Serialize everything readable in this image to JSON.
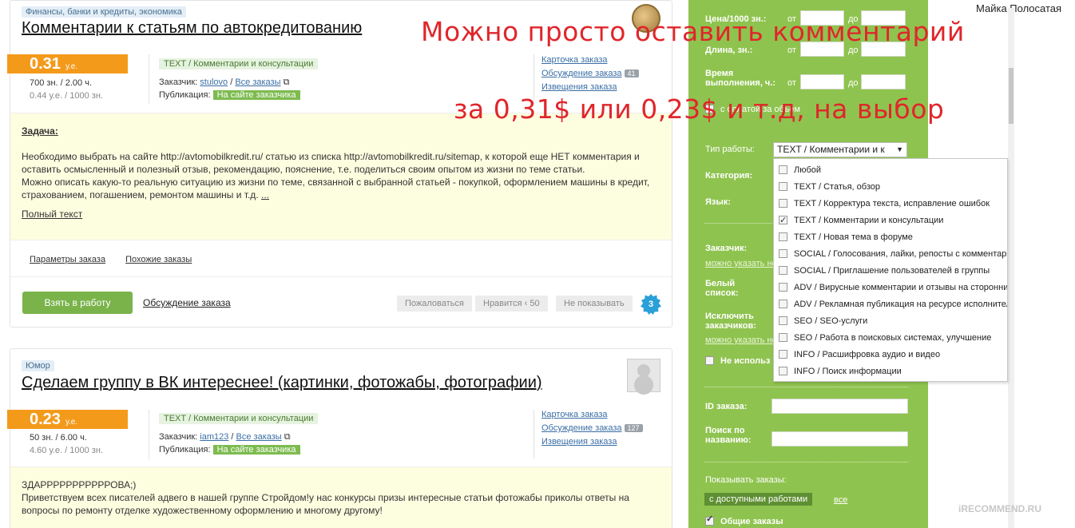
{
  "user": {
    "name": "Майка Полосатая"
  },
  "annotation": {
    "line1": "Можно просто оставить комментарий",
    "line2": "за 0,31$ или 0,23$ и т.д, на выбор"
  },
  "orders": [
    {
      "category": "Финансы, банки и кредиты, экономика",
      "title": "Комментарии к статьям по автокредитованию",
      "price": "0.31",
      "currency": "у.е.",
      "volume": "700 зн. / 2.00 ч.",
      "rate": "0.44 у.е. / 1000 зн.",
      "work_type": "TEXT / Комментарии и консультации",
      "customer_label": "Заказчик:",
      "customer": "stulovo",
      "all_orders": "Все заказы",
      "publication_label": "Публикация:",
      "publication": "На сайте заказчика",
      "links": {
        "card": "Карточка заказа",
        "discussion": "Обсуждение заказа",
        "discussion_count": "41",
        "notices": "Извещения заказа"
      },
      "task_heading": "Задача:",
      "task_text": "Необходимо выбрать на сайте http://avtomobilkredit.ru/ статью из списка http://avtomobilkredit.ru/sitemap, к которой еще НЕТ комментария и оставить осмысленный и полезный отзыв, рекомендацию, пояснение, т.е. поделиться своим опытом из жизни по теме статьи.",
      "task_text2": "Можно описать какую-то реальную ситуацию из жизни по теме, связанной с выбранной статьей - покупкой, оформлением машины в кредит, страхованием, погашением, ремонтом машины и т.д.",
      "more": "...",
      "full_text": "Полный текст",
      "params": "Параметры заказа",
      "similar": "Похожие заказы",
      "take_button": "Взять в работу",
      "discussion_link": "Обсуждение заказа",
      "complain": "Пожаловаться",
      "likes": "Нравится",
      "likes_count": "50",
      "hide": "Не показывать",
      "badge": "3"
    },
    {
      "category": "Юмор",
      "title": "Сделаем группу в ВК интереснее! (картинки, фотожабы, фотографии)",
      "price": "0.23",
      "currency": "у.е.",
      "volume": "50 зн. / 6.00 ч.",
      "rate": "4.60 у.е. / 1000 зн.",
      "work_type": "TEXT / Комментарии и консультации",
      "customer_label": "Заказчик:",
      "customer": "iam123",
      "all_orders": "Все заказы",
      "publication_label": "Публикация:",
      "publication": "На сайте заказчика",
      "links": {
        "card": "Карточка заказа",
        "discussion": "Обсуждение заказа",
        "discussion_count": "127",
        "notices": "Извещения заказа"
      },
      "task_line1": "ЗДАРРРРРРРРРРРОВА;)",
      "task_line2": "Приветствуем всех писателей адвего в нашей группе Стройдом!у нас конкурсы призы интересные статьи фотожабы приколы ответы на вопросы по ремонту отделке художественному оформлению и многому другому!"
    }
  ],
  "filter": {
    "price_label": "Цена/1000 зн.:",
    "length_label": "Длина, зн.:",
    "time_label": "Время выполнения, ч.:",
    "from": "от",
    "to": "до",
    "volume_check": "с оплатой за объем",
    "work_type_label": "Тип работы:",
    "work_type_value": "TEXT / Комментарии и к",
    "category_label": "Категория:",
    "language_label": "Язык:",
    "customer_label": "Заказчик:",
    "customer_hint": "можно указать не",
    "whitelist_label": "Белый список:",
    "exclude_label": "Исключить заказчиков:",
    "exclude_hint": "можно указать не",
    "not_use": "Не использ",
    "order_id_label": "ID заказа:",
    "name_search_label": "Поиск по названию:",
    "show_label": "Показывать заказы:",
    "show_available": "с доступными работами",
    "show_all": "все",
    "common_orders": "Общие заказы"
  },
  "work_types": [
    {
      "label": "Любой",
      "checked": false
    },
    {
      "label": "TEXT / Статья, обзор",
      "checked": false
    },
    {
      "label": "TEXT / Корректура текста, исправление ошибок",
      "checked": false
    },
    {
      "label": "TEXT / Комментарии и консультации",
      "checked": true
    },
    {
      "label": "TEXT / Новая тема в форуме",
      "checked": false
    },
    {
      "label": "SOCIAL / Голосования, лайки, репосты с комментариями",
      "checked": false
    },
    {
      "label": "SOCIAL / Приглашение пользователей в группы",
      "checked": false
    },
    {
      "label": "ADV / Вирусные комментарии и отзывы на сторонних",
      "checked": false
    },
    {
      "label": "ADV / Рекламная публикация на ресурсе исполнителя",
      "checked": false
    },
    {
      "label": "SEO / SEO-услуги",
      "checked": false
    },
    {
      "label": "SEO / Работа в поисковых системах, улучшение",
      "checked": false
    },
    {
      "label": "INFO / Расшифровка аудио и видео",
      "checked": false
    },
    {
      "label": "INFO / Поиск информации",
      "checked": false
    }
  ],
  "watermark": "iRECOMMEND.RU"
}
